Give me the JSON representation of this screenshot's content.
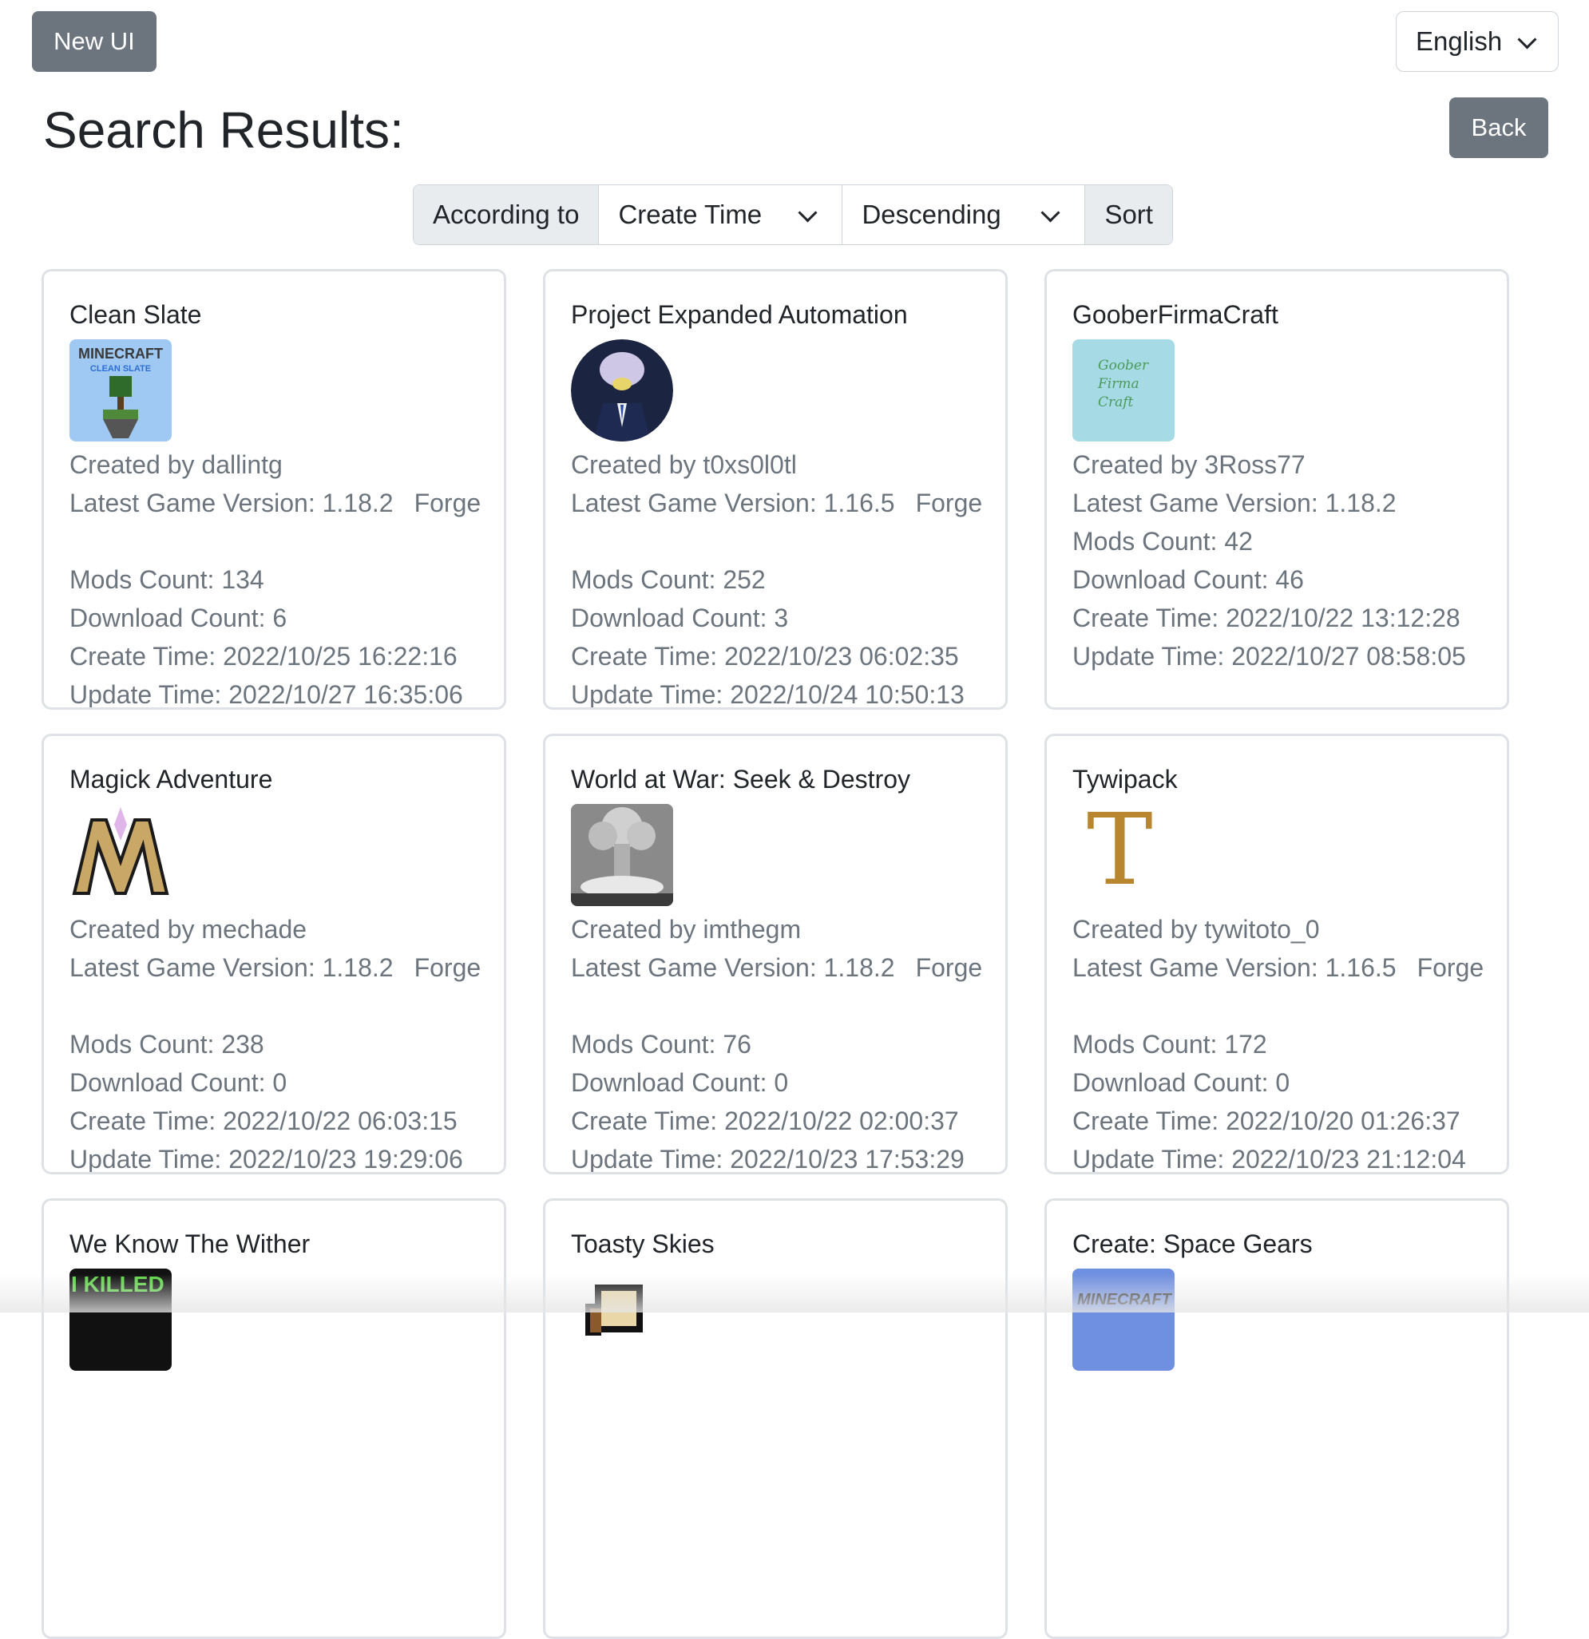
{
  "header": {
    "new_ui_label": "New UI",
    "language": "English",
    "title": "Search Results:",
    "back_label": "Back"
  },
  "sort_bar": {
    "prefix": "According to",
    "field": "Create Time",
    "order": "Descending",
    "sort_label": "Sort"
  },
  "cards": [
    {
      "title": "Clean Slate",
      "created_by": "Created by dallintg",
      "version": "Latest Game Version: 1.18.2",
      "loader": "Forge",
      "mods": "Mods Count: 134",
      "downloads": "Download Count: 6",
      "create_time": "Create Time: 2022/10/25 16:22:16",
      "update_time": "Update Time: 2022/10/27 16:35:06",
      "thumb_text": "MINECRAFT CLEAN SLATE"
    },
    {
      "title": "Project Expanded Automation",
      "created_by": "Created by t0xs0l0tl",
      "version": "Latest Game Version: 1.16.5",
      "loader": "Forge",
      "mods": "Mods Count: 252",
      "downloads": "Download Count: 3",
      "create_time": "Create Time: 2022/10/23 06:02:35",
      "update_time": "Update Time: 2022/10/24 10:50:13"
    },
    {
      "title": "GooberFirmaCraft",
      "created_by": "Created by 3Ross77",
      "version": "Latest Game Version: 1.18.2",
      "loader": "",
      "mods": "Mods Count: 42",
      "downloads": "Download Count: 46",
      "create_time": "Create Time: 2022/10/22 13:12:28",
      "update_time": "Update Time: 2022/10/27 08:58:05",
      "thumb_text": [
        "Goober",
        "Firma",
        "Craft"
      ]
    },
    {
      "title": "Magick Adventure",
      "created_by": "Created by mechade",
      "version": "Latest Game Version: 1.18.2",
      "loader": "Forge",
      "mods": "Mods Count: 238",
      "downloads": "Download Count: 0",
      "create_time": "Create Time: 2022/10/22 06:03:15",
      "update_time": "Update Time: 2022/10/23 19:29:06",
      "thumb_text": "M"
    },
    {
      "title": "World at War: Seek & Destroy",
      "created_by": "Created by imthegm",
      "version": "Latest Game Version: 1.18.2",
      "loader": "Forge",
      "mods": "Mods Count: 76",
      "downloads": "Download Count: 0",
      "create_time": "Create Time: 2022/10/22 02:00:37",
      "update_time": "Update Time: 2022/10/23 17:53:29"
    },
    {
      "title": "Tywipack",
      "created_by": "Created by tywitoto_0",
      "version": "Latest Game Version: 1.16.5",
      "loader": "Forge",
      "mods": "Mods Count: 172",
      "downloads": "Download Count: 0",
      "create_time": "Create Time: 2022/10/20 01:26:37",
      "update_time": "Update Time: 2022/10/23 21:12:04",
      "thumb_text": "T"
    },
    {
      "title": "We Know The Wither",
      "thumb_text": "I KILLED"
    },
    {
      "title": "Toasty Skies"
    },
    {
      "title": "Create: Space Gears",
      "thumb_text": "MINECRAFT"
    }
  ]
}
